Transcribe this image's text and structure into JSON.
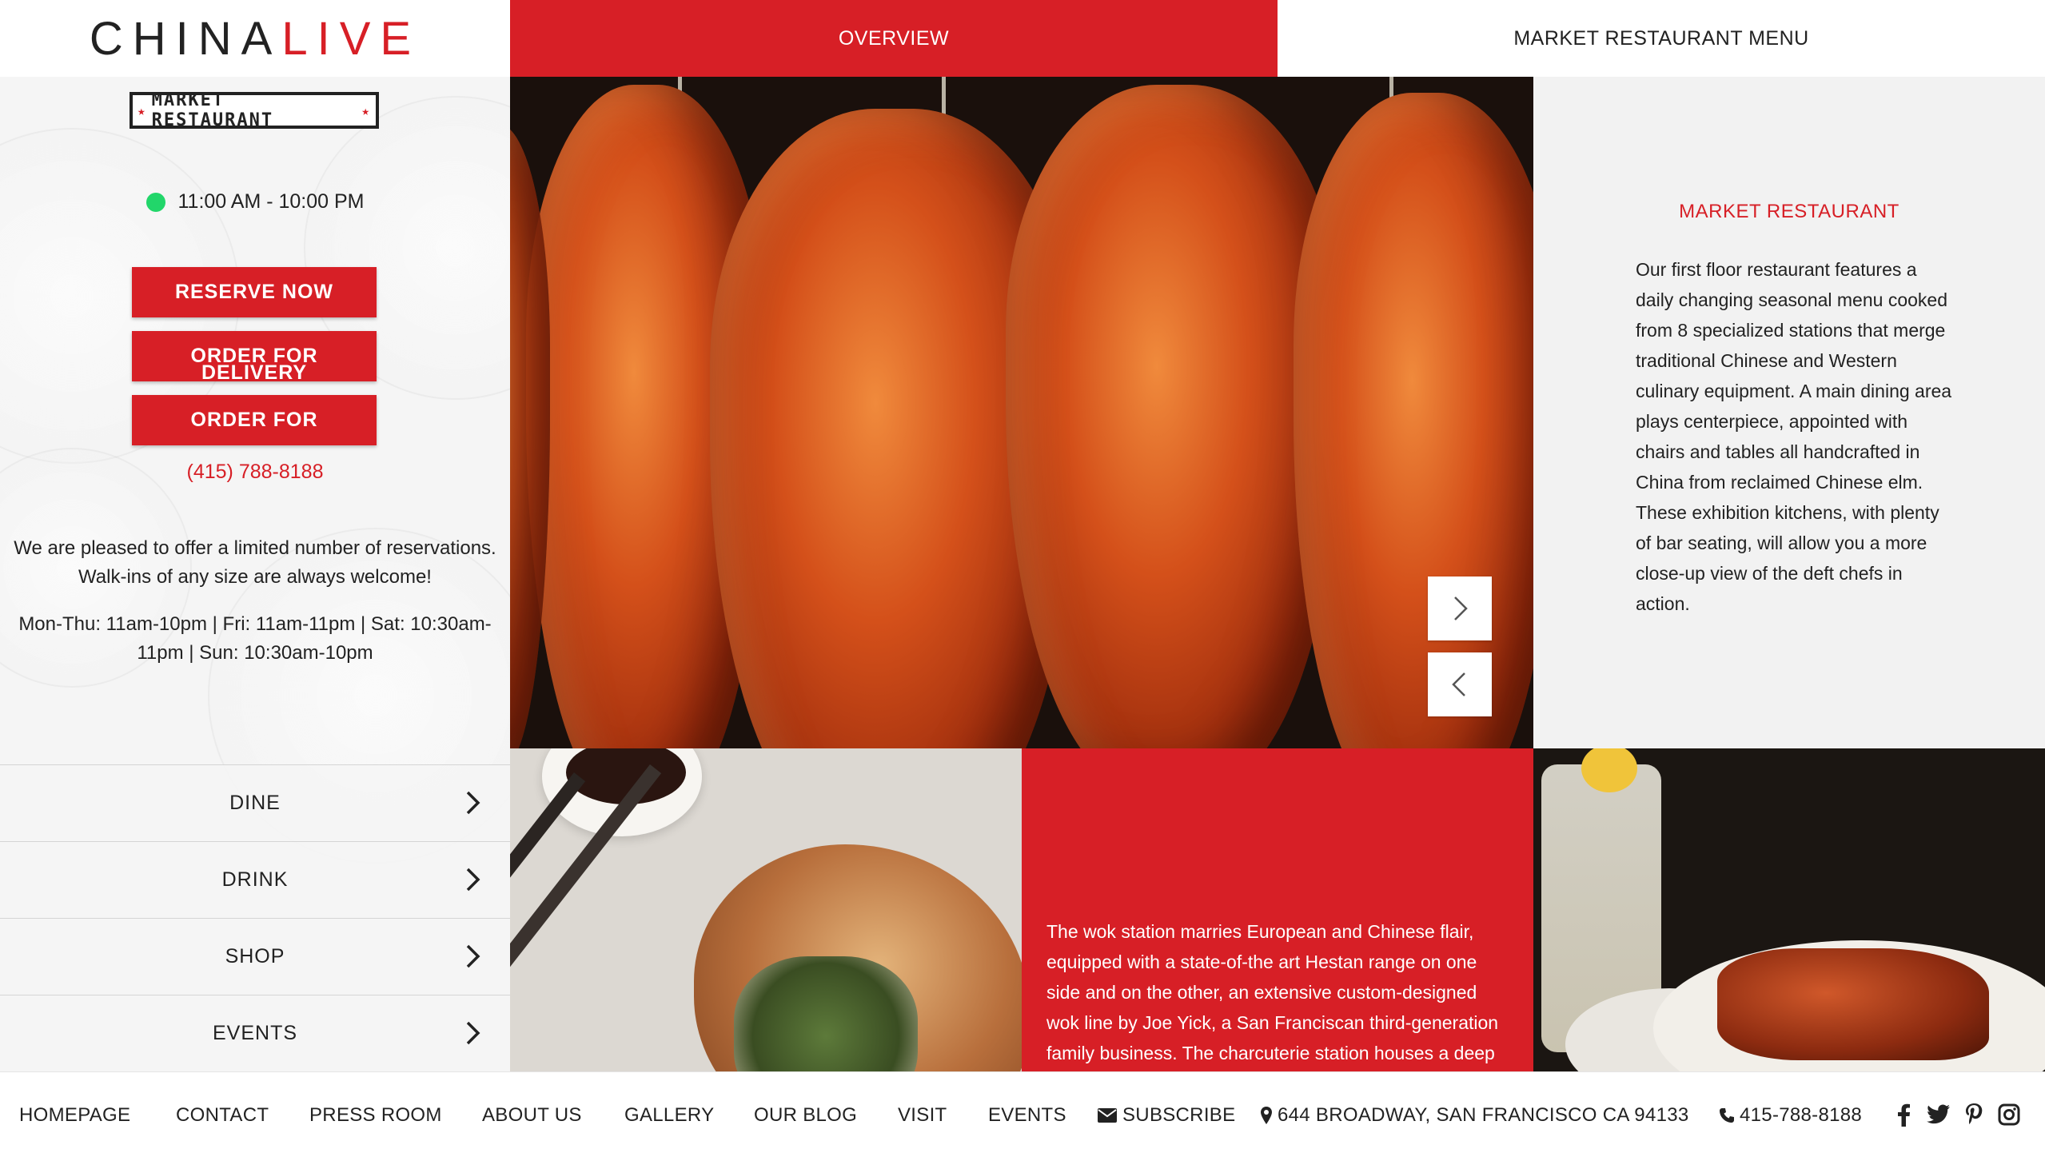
{
  "brand": {
    "part1": "CHINA",
    "part2": "LIVE"
  },
  "left": {
    "badge": "MARKET RESTAURANT",
    "hours": "11:00 AM - 10:00 PM",
    "status_color": "#22d66a",
    "buttons": {
      "reserve": "RESERVE NOW",
      "order1": "ORDER FOR",
      "order1_overflow": "DELIVERY",
      "order2": "ORDER FOR"
    },
    "phone": "(415) 788-8188",
    "reservation_line1": "We are pleased to offer a limited number of reservations.",
    "reservation_line2": "Walk-ins of any size are always welcome!",
    "schedule_line1": "Mon-Thu: 11am-10pm | Fri: 11am-11pm | Sat: 10:30am-",
    "schedule_line2": "11pm | Sun: 10:30am-10pm",
    "nav": [
      "DINE",
      "DRINK",
      "SHOP",
      "EVENTS"
    ]
  },
  "tabs": {
    "overview": "OVERVIEW",
    "menu": "MARKET RESTAURANT MENU"
  },
  "info": {
    "title": "MARKET RESTAURANT",
    "body": "Our first floor restaurant features a daily changing seasonal menu cooked from 8 specialized stations that merge traditional Chinese and Western culinary equipment. A main dining area plays centerpiece, appointed with chairs and tables all handcrafted in China from reclaimed Chinese elm. These exhibition kitchens, with plenty of bar seating, will allow you a more close-up view of the deft chefs in action."
  },
  "tile_text": "The wok station marries European and Chinese flair, equipped with a state-of-the art Hestan range on one side and on the other, an extensive custom-designed wok line by Joe Yick, a San Franciscan third-generation family business. The charcuterie station houses a deep",
  "footer": {
    "links": [
      "HOMEPAGE",
      "CONTACT",
      "PRESS ROOM",
      "ABOUT US",
      "GALLERY",
      "OUR BLOG",
      "VISIT",
      "EVENTS"
    ],
    "subscribe": "SUBSCRIBE",
    "address": "644 BROADWAY, SAN FRANCISCO CA 94133",
    "phone": "415-788-8188"
  },
  "colors": {
    "brand_red": "#d71f26"
  }
}
